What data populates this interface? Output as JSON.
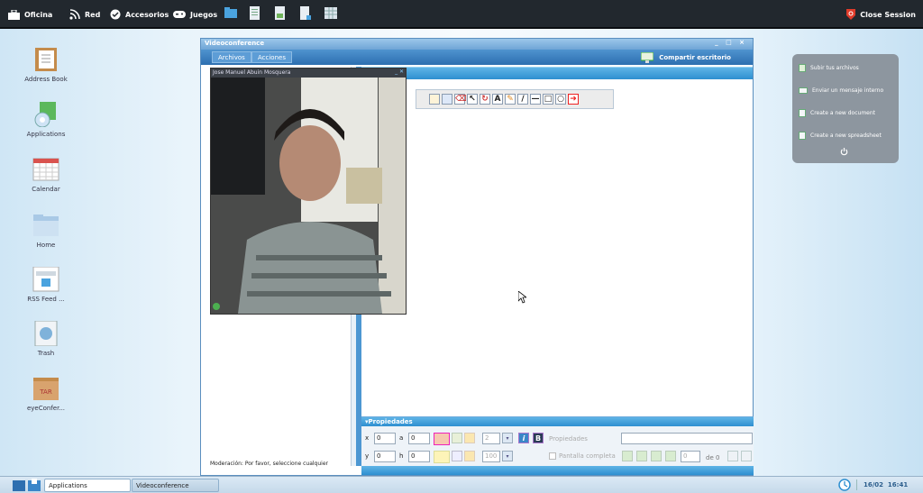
{
  "topbar": {
    "menus": [
      {
        "label": "Oficina",
        "icon": "briefcase-icon"
      },
      {
        "label": "Red",
        "icon": "rss-icon"
      },
      {
        "label": "Accesorios",
        "icon": "check-circle-icon"
      },
      {
        "label": "Juegos",
        "icon": "gamepad-icon"
      }
    ],
    "tray_icons": [
      "folder-icon",
      "document-icon",
      "spreadsheet-icon",
      "book-icon",
      "grid-icon"
    ],
    "close_session": "Close Session"
  },
  "desktop_icons": [
    {
      "label": "Address Book",
      "icon": "address-book-icon"
    },
    {
      "label": "Applications",
      "icon": "applications-icon"
    },
    {
      "label": "Calendar",
      "icon": "calendar-icon"
    },
    {
      "label": "Home",
      "icon": "home-folder-icon"
    },
    {
      "label": "RSS Feed ...",
      "icon": "rss-feed-icon"
    },
    {
      "label": "Trash",
      "icon": "trash-icon"
    },
    {
      "label": "eyeConfer...",
      "icon": "tar-archive-icon"
    }
  ],
  "window": {
    "title": "Videoconference",
    "controls": "_ □ ×",
    "menus": [
      "Archivos",
      "Acciones"
    ],
    "share_label": "Compartir escritorio",
    "video_title": "Jose Manuel Abuin Mosquera",
    "moderation_text": "Moderación: Por favor, seleccione cualquier",
    "properties": {
      "title": "Propiedades",
      "x_label": "x",
      "x_value": "0",
      "y_label": "y",
      "y_value": "0",
      "a_label": "a",
      "a_value": "0",
      "h_label": "h",
      "h_value": "0",
      "line_width": "2",
      "opacity": "100",
      "italic": "i",
      "bold": "B",
      "props_placeholder": "Propiedades",
      "fullscreen_label": "Pantalla completa",
      "page_value": "0",
      "of_label": "de 0"
    },
    "toolbar_glyphs": [
      "A"
    ]
  },
  "right_panel": {
    "items": [
      "Subir tus archivos",
      "Enviar un mensaje interno",
      "Create a new document",
      "Create a new spreadsheet"
    ],
    "power_icon": "power-icon"
  },
  "taskbar": {
    "buttons": [
      "Applications",
      "Videoconference"
    ],
    "clock": "16/02  16:41",
    "accent": "#2e8fd0"
  }
}
